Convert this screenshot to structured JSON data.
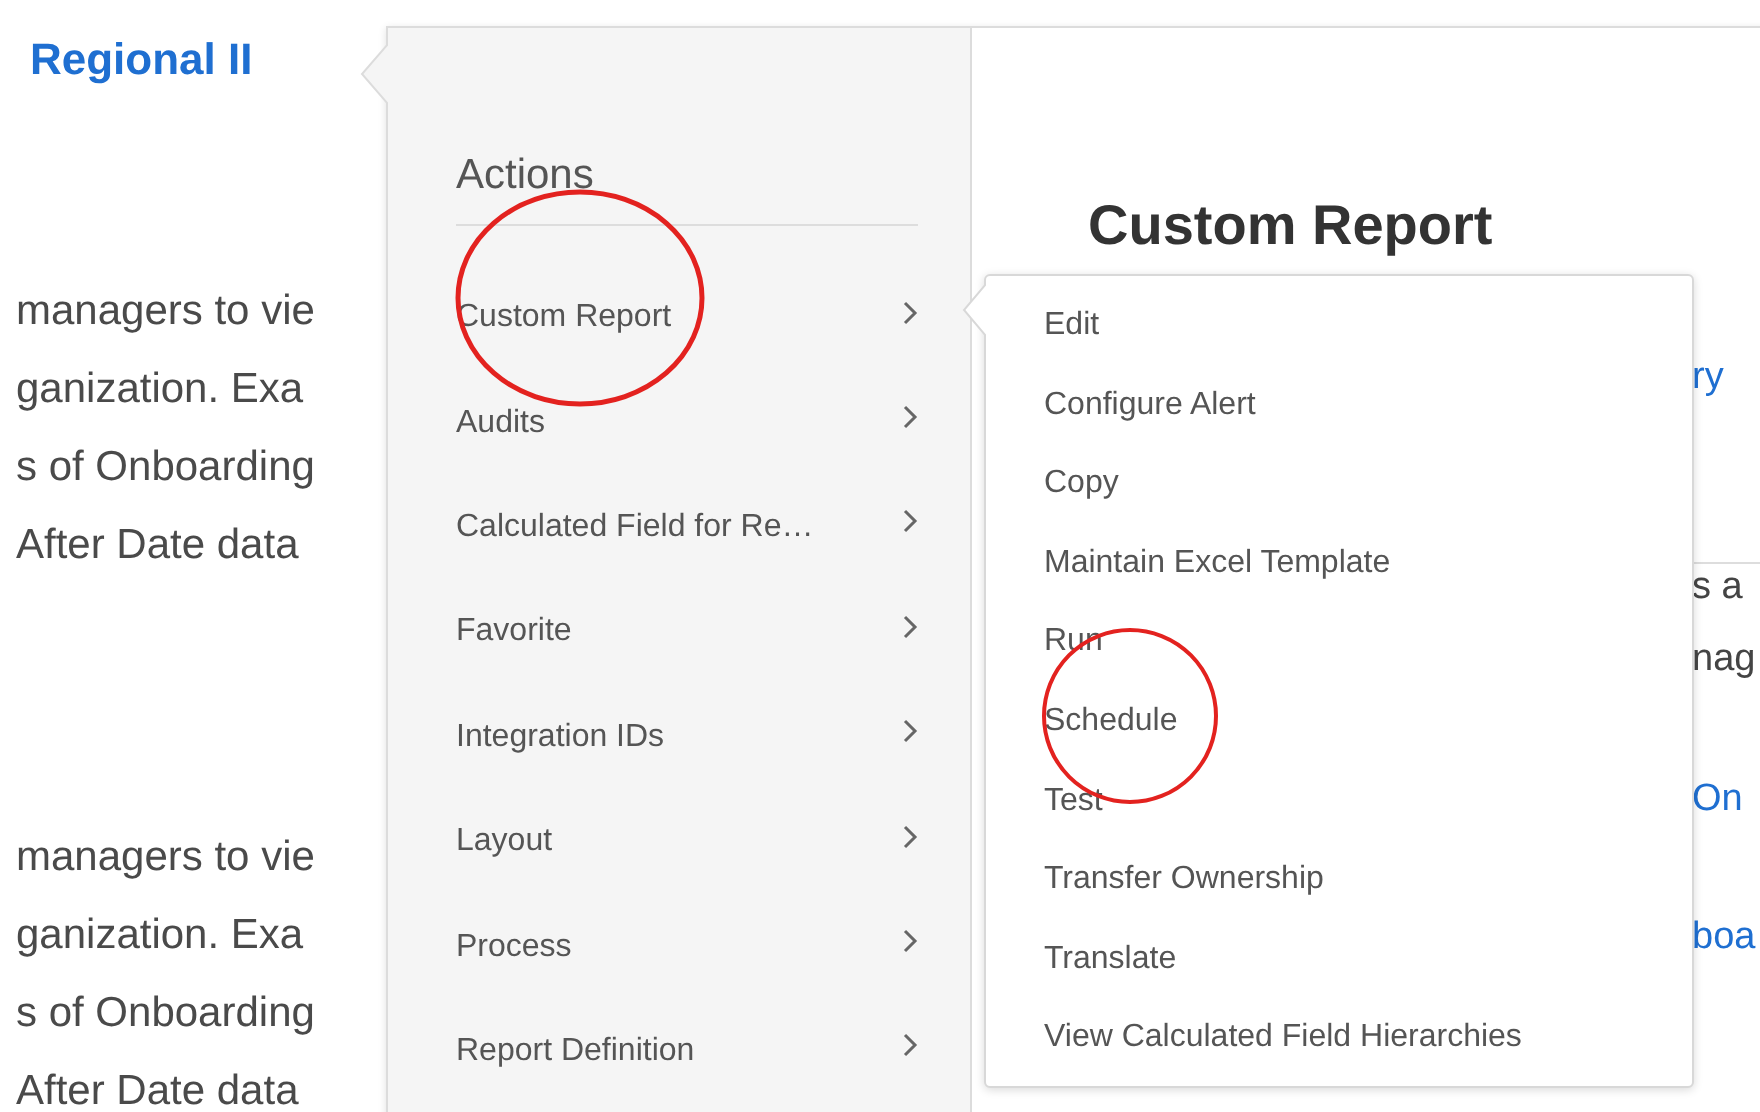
{
  "page": {
    "title": "Regional II",
    "paragraphs": [
      [
        "managers to vie",
        "ganization. Exa",
        "s of Onboarding",
        "After Date data"
      ],
      [
        "managers to vie",
        "ganization. Exa",
        "s of Onboarding",
        "After Date data"
      ]
    ]
  },
  "actions_menu": {
    "heading": "Actions",
    "items": [
      {
        "label": "Custom Report"
      },
      {
        "label": "Audits"
      },
      {
        "label": "Calculated Field for Re…"
      },
      {
        "label": "Favorite"
      },
      {
        "label": "Integration IDs"
      },
      {
        "label": "Layout"
      },
      {
        "label": "Process"
      },
      {
        "label": "Report Definition"
      }
    ]
  },
  "detail_panel": {
    "title": "Custom Report",
    "fragments": [
      {
        "text": "ry",
        "kind": "link"
      },
      {
        "text": "s a",
        "kind": "text"
      },
      {
        "text": "nag",
        "kind": "text"
      },
      {
        "text": "On",
        "kind": "link"
      },
      {
        "text": "boa",
        "kind": "link"
      }
    ]
  },
  "submenu": {
    "items": [
      "Edit",
      "Configure Alert",
      "Copy",
      "Maintain Excel Template",
      "Run",
      "Schedule",
      "Test",
      "Transfer Ownership",
      "Translate",
      "View Calculated Field Hierarchies"
    ]
  }
}
